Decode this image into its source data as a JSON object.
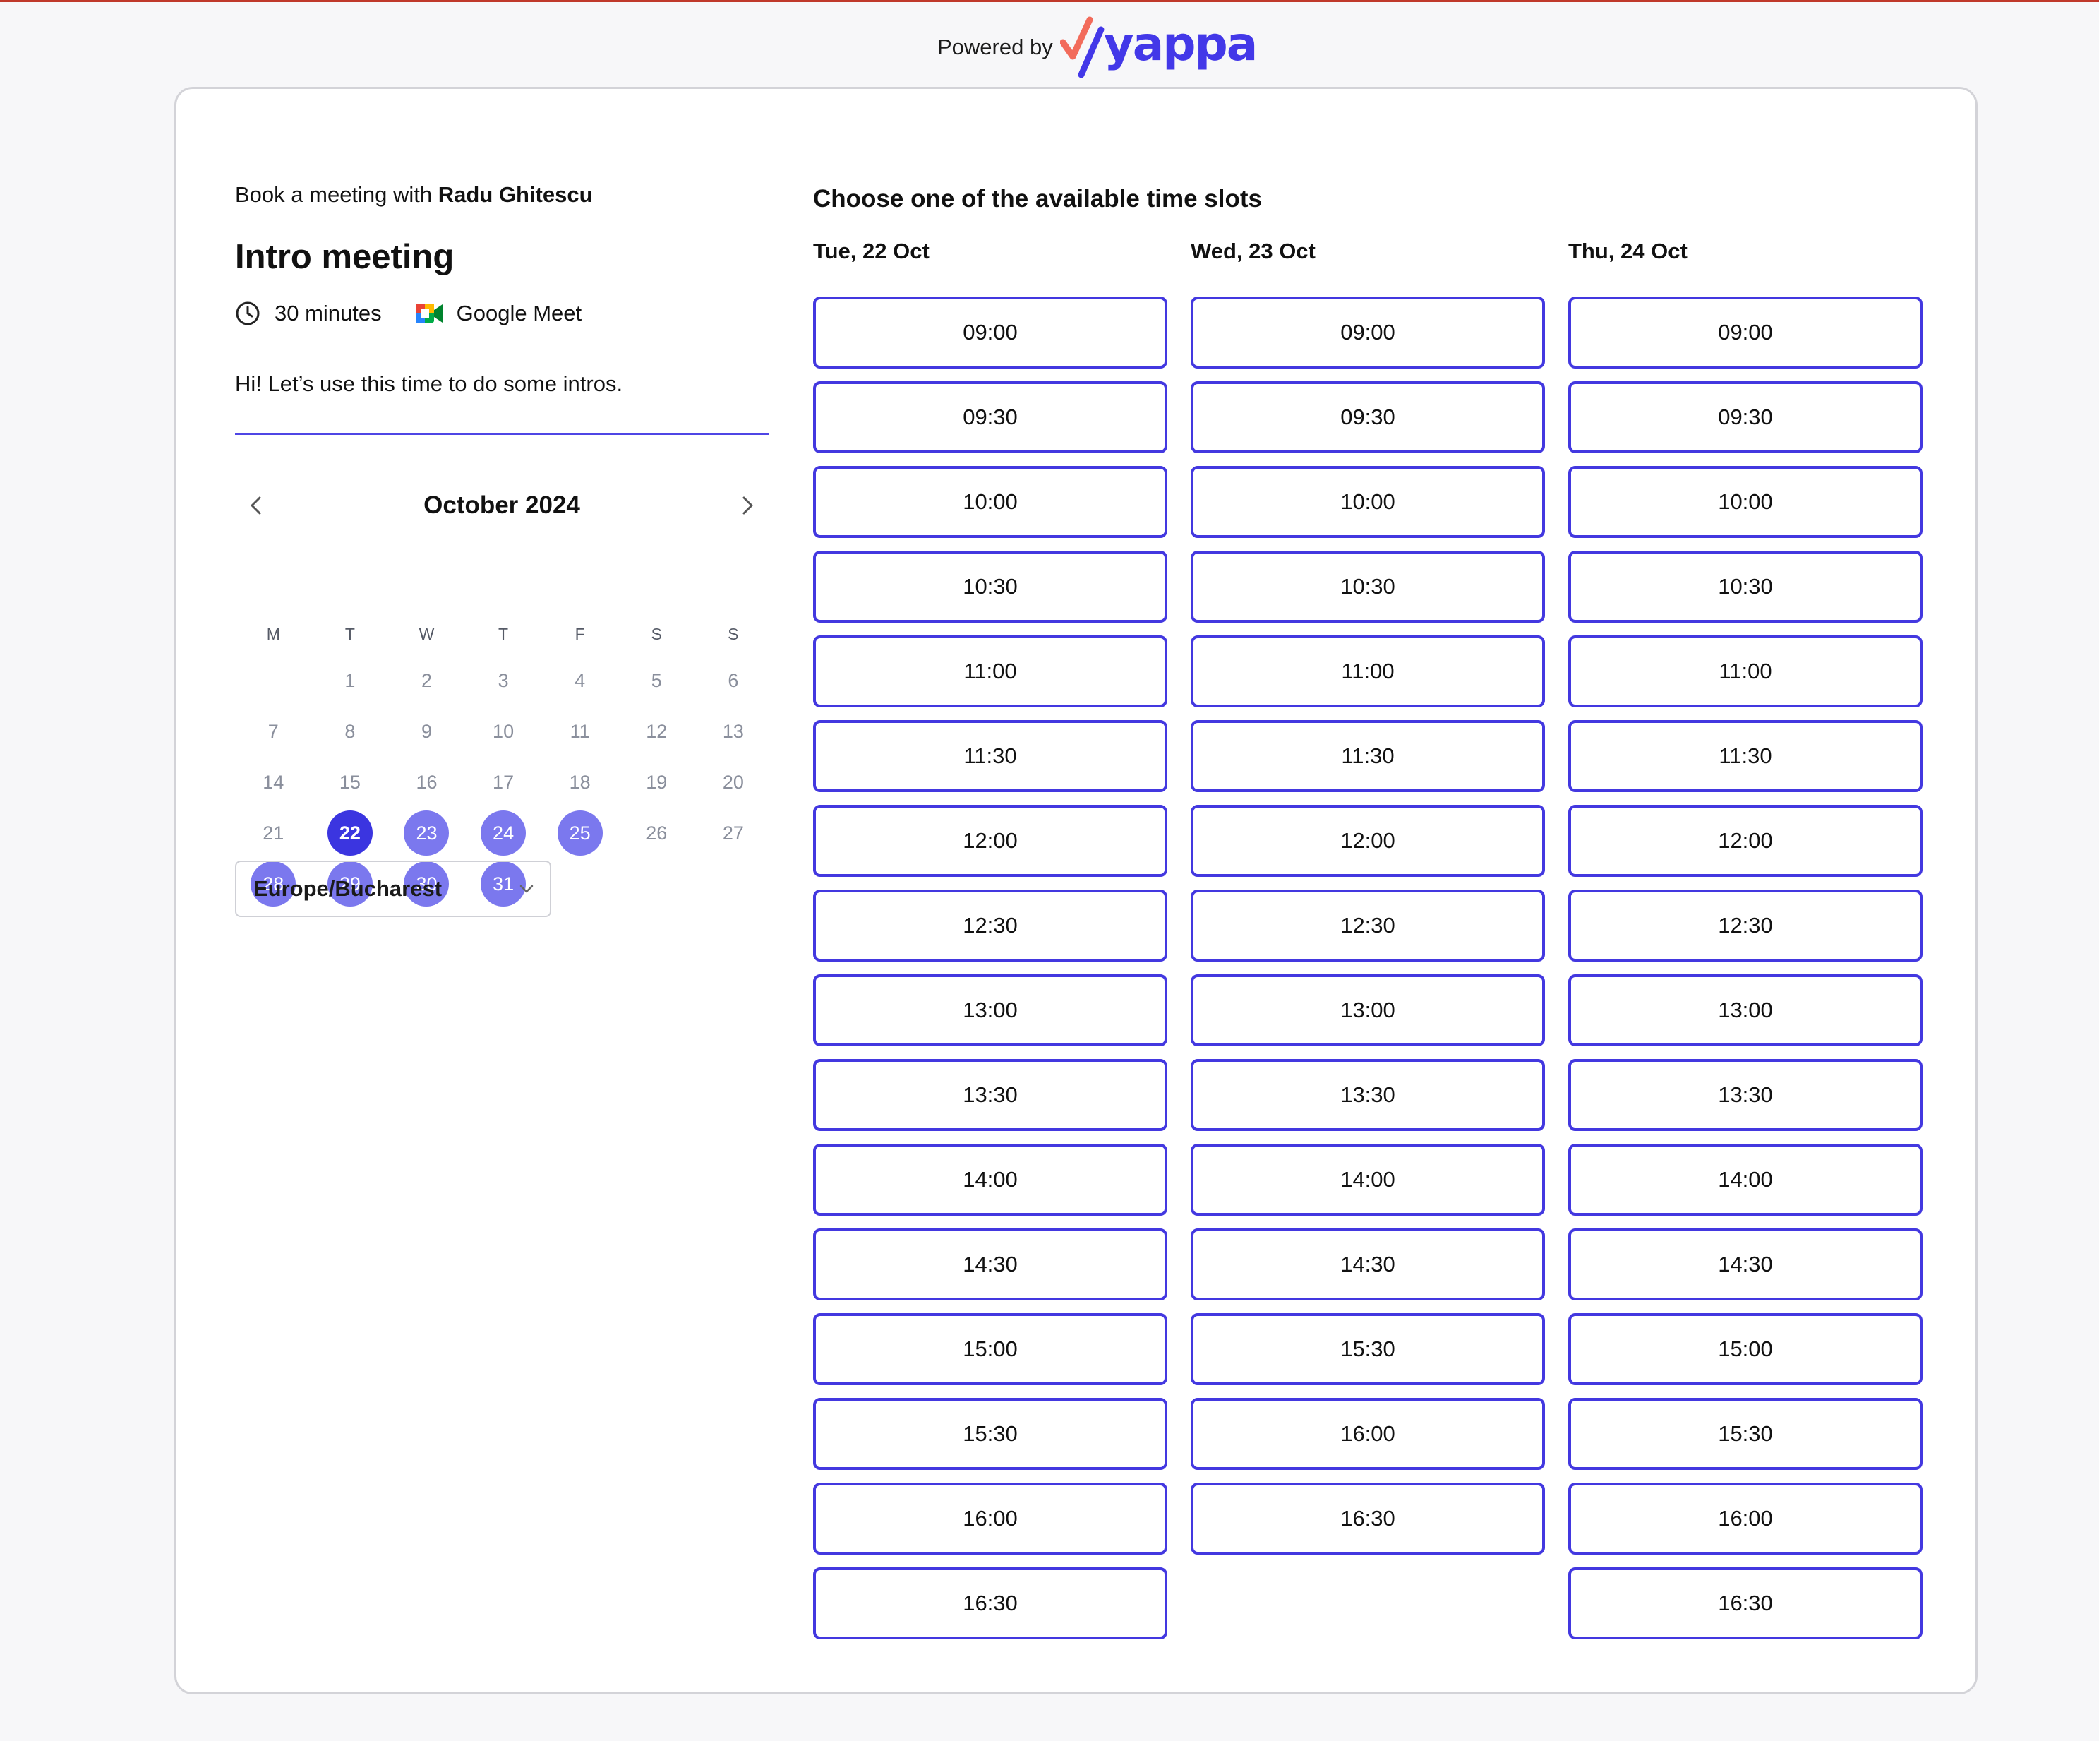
{
  "header": {
    "powered_by": "Powered by",
    "brand": "yappa",
    "brand_colors": {
      "check": "#f26b5b",
      "word": "#4338e8"
    }
  },
  "event": {
    "book_prefix": "Book a meeting with",
    "host": "Radu Ghitescu",
    "title": "Intro meeting",
    "duration": "30 minutes",
    "duration_icon": "clock-icon",
    "location": "Google Meet",
    "location_icon": "google-meet-icon",
    "description": "Hi! Let’s use this time to do some intros."
  },
  "calendar": {
    "month_label": "October 2024",
    "prev_icon": "chevron-left-icon",
    "next_icon": "chevron-right-icon",
    "weekdays": [
      "M",
      "T",
      "W",
      "T",
      "F",
      "S",
      "S"
    ],
    "leading_blank_days": 1,
    "days": [
      "1",
      "2",
      "3",
      "4",
      "5",
      "6",
      "7",
      "8",
      "9",
      "10",
      "11",
      "12",
      "13",
      "14",
      "15",
      "16",
      "17",
      "18",
      "19",
      "20",
      "21",
      "22",
      "23",
      "24",
      "25",
      "26",
      "27",
      "28",
      "29",
      "30",
      "31"
    ],
    "available_days": [
      "22",
      "23",
      "24",
      "25",
      "28",
      "29",
      "30",
      "31"
    ],
    "selected_day": "22",
    "colors": {
      "selected": "#3b35e0",
      "available": "#7b78ee",
      "muted": "#8a8f9c"
    }
  },
  "timezone": {
    "value": "Europe/Bucharest",
    "icon": "chevron-down-icon"
  },
  "slots": {
    "heading": "Choose one of the available time slots",
    "accent": "#4338e0",
    "columns": [
      {
        "label": "Tue, 22 Oct",
        "times": [
          "09:00",
          "09:30",
          "10:00",
          "10:30",
          "11:00",
          "11:30",
          "12:00",
          "12:30",
          "13:00",
          "13:30",
          "14:00",
          "14:30",
          "15:00",
          "15:30",
          "16:00",
          "16:30"
        ]
      },
      {
        "label": "Wed, 23 Oct",
        "times": [
          "09:00",
          "09:30",
          "10:00",
          "10:30",
          "11:00",
          "11:30",
          "12:00",
          "12:30",
          "13:00",
          "13:30",
          "14:00",
          "14:30",
          "15:30",
          "16:00",
          "16:30"
        ]
      },
      {
        "label": "Thu, 24 Oct",
        "times": [
          "09:00",
          "09:30",
          "10:00",
          "10:30",
          "11:00",
          "11:30",
          "12:00",
          "12:30",
          "13:00",
          "13:30",
          "14:00",
          "14:30",
          "15:00",
          "15:30",
          "16:00",
          "16:30"
        ]
      }
    ]
  }
}
